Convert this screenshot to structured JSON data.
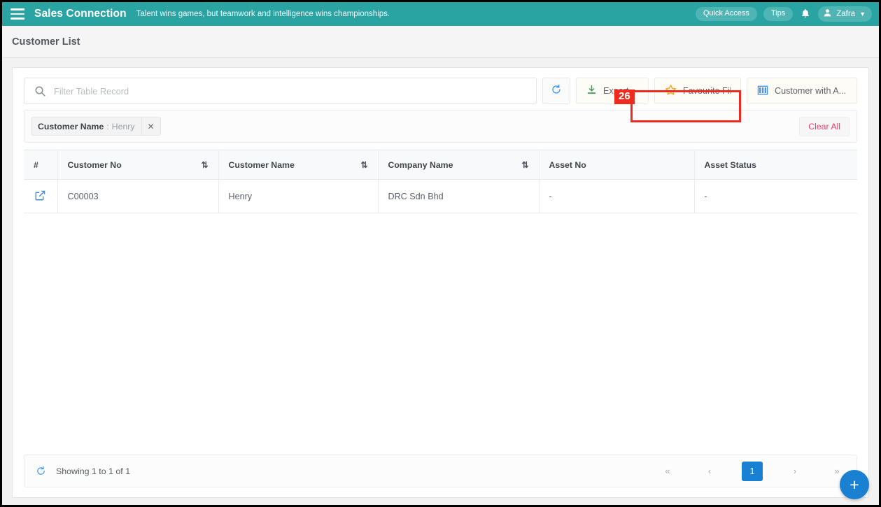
{
  "navbar": {
    "menu_icon": "hamburger-icon",
    "brand": "Sales Connection",
    "tagline": "Talent wins games, but teamwork and intelligence wins championships.",
    "quick_access_label": "Quick Access",
    "tips_label": "Tips",
    "notification_icon": "bell-icon",
    "user_name": "Zafra",
    "user_icon": "person-icon",
    "caret_icon": "chevron-down-icon",
    "brand_color": "#2aa3a3"
  },
  "page": {
    "title": "Customer List"
  },
  "toolbar": {
    "search_placeholder": "Filter Table Record",
    "search_value": "",
    "search_icon": "search-icon",
    "refresh_icon": "refresh-icon",
    "export_label": "Export",
    "export_icon": "download-icon",
    "favourite_filter_label": "Favourite Filter",
    "favourite_filter_icon": "star-icon",
    "customer_with_asset_label": "Customer with A...",
    "customer_with_asset_icon": "columns-icon"
  },
  "highlight": {
    "badge": "26",
    "color": "#ee2b20",
    "target": "favourite-filter-button"
  },
  "filters": {
    "chips": [
      {
        "key": "Customer Name",
        "separator": ":",
        "value": "Henry",
        "remove_icon": "close-icon"
      }
    ],
    "clear_all_label": "Clear All",
    "clear_all_color": "#f0416a"
  },
  "table": {
    "columns": [
      {
        "label": "#",
        "sortable": false
      },
      {
        "label": "Customer No",
        "sortable": true,
        "sort_icon": "sort-icon"
      },
      {
        "label": "Customer Name",
        "sortable": true,
        "sort_icon": "sort-icon"
      },
      {
        "label": "Company Name",
        "sortable": true,
        "sort_icon": "sort-icon"
      },
      {
        "label": "Asset No",
        "sortable": false
      },
      {
        "label": "Asset Status",
        "sortable": false
      }
    ],
    "rows": [
      {
        "open_icon": "external-link-icon",
        "customer_no": "C00003",
        "customer_name": "Henry",
        "company_name": "DRC Sdn Bhd",
        "asset_no": "-",
        "asset_status": "-"
      }
    ]
  },
  "footer": {
    "refresh_icon": "refresh-icon",
    "showing_text": "Showing 1 to 1 of 1",
    "pagination": {
      "first_label": "«",
      "prev_label": "‹",
      "pages": [
        "1"
      ],
      "current_page": "1",
      "next_label": "›",
      "last_label": "»",
      "active_color": "#1a80d1"
    }
  },
  "fab": {
    "label": "+",
    "icon": "plus-icon",
    "color": "#1a80d1"
  }
}
